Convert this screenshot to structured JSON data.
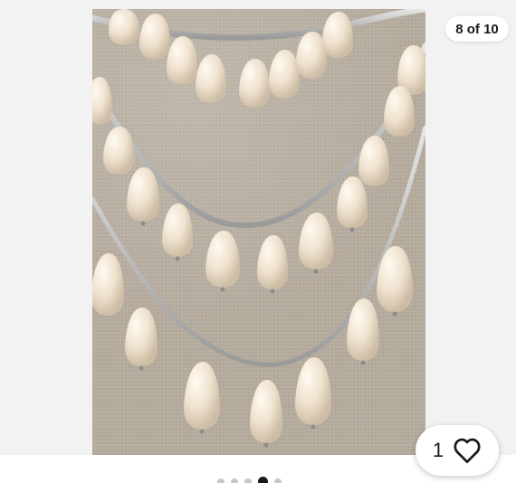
{
  "gallery": {
    "counter_label": "8 of 10",
    "image_alt": "",
    "watch": {
      "count": "1",
      "icon": "heart-icon"
    },
    "pagination": {
      "visible_dots": 5,
      "active_index": 3
    }
  },
  "colors": {
    "background": "#f2f2f2",
    "photo_linen": "#b7ad9f",
    "pearl": "#f2e6d6",
    "chain": "#cfcfcf",
    "text": "#191919",
    "dot_inactive": "#c7c7c7",
    "dot_active": "#191919"
  }
}
